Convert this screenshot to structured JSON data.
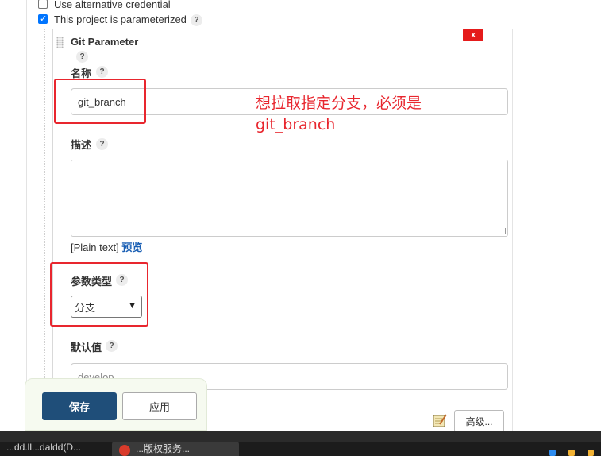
{
  "options": {
    "alt_credential_label": "Use alternative credential",
    "alt_credential_checked": false,
    "parameterized_label": "This project is parameterized",
    "parameterized_checked": true
  },
  "param_block": {
    "title": "Git Parameter",
    "delete_label": "x",
    "help_glyph": "?",
    "name_label": "名称",
    "name_value": "git_branch",
    "description_label": "描述",
    "description_value": "",
    "plain_text_prefix": "[Plain text]",
    "preview_link": "预览",
    "param_type_label": "参数类型",
    "param_type_value": "分支",
    "default_label": "默认值",
    "default_value": "develop",
    "advanced_button": "高级..."
  },
  "annotation": {
    "line1": "想拉取指定分支，必须是",
    "line2": "git_branch",
    "color": "#e8262e"
  },
  "save_bar": {
    "save_label": "保存",
    "apply_label": "应用"
  },
  "taskbar": {
    "item1": "...dd.ll...daldd(D...",
    "item2": "...版权服务..."
  },
  "colors": {
    "accent_save": "#1f4e79",
    "delete_red": "#e51b1b",
    "checkbox_blue": "#0075ff",
    "link_blue": "#1a5fb4"
  },
  "icons": {
    "help": "question-circle",
    "delete": "close-x",
    "notepad": "notepad-pencil",
    "chevron": "chevron-down"
  }
}
